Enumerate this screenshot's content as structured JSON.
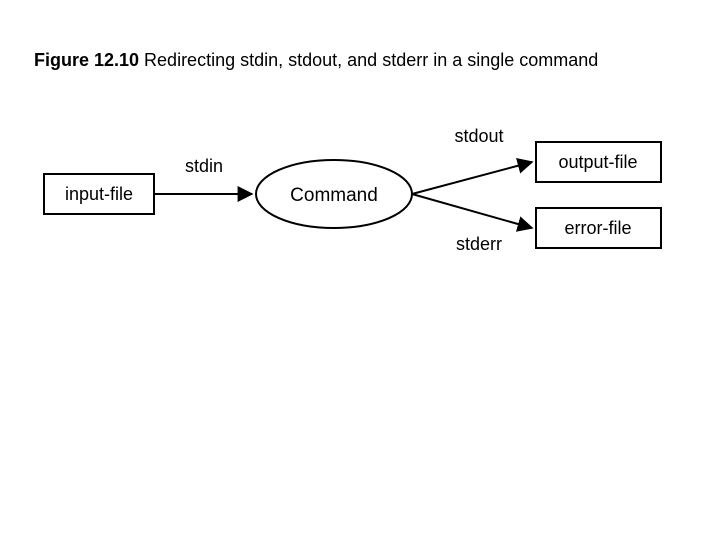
{
  "caption": {
    "figlabel": "Figure 12.10",
    "text": "  Redirecting stdin, stdout, and stderr in a single command"
  },
  "nodes": {
    "input_file": "input-file",
    "command": "Command",
    "output_file": "output-file",
    "error_file": "error-file"
  },
  "edges": {
    "stdin": "stdin",
    "stdout": "stdout",
    "stderr": "stderr"
  }
}
